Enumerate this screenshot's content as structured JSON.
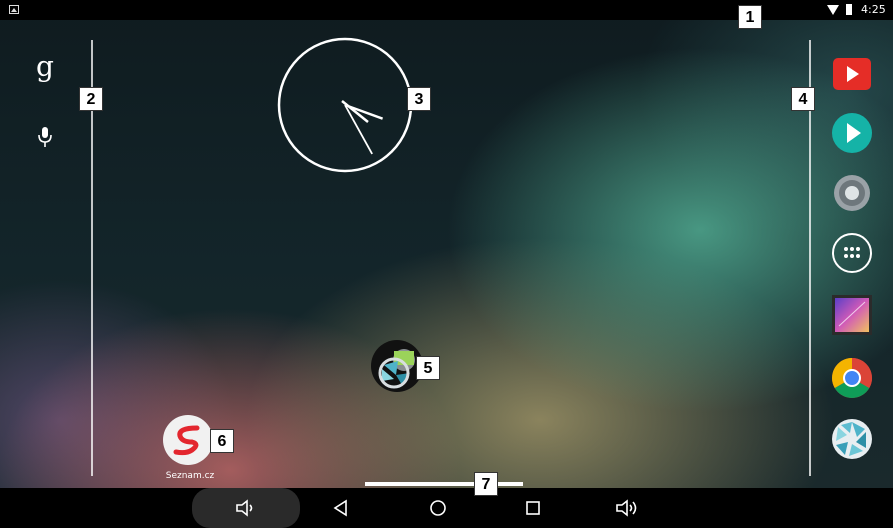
{
  "status_bar": {
    "notification_icon": "image-icon",
    "wifi_icon": "wifi-icon",
    "battery_icon": "battery-icon",
    "time": "4:25"
  },
  "left_panel": {
    "google_search_glyph": "g",
    "voice_icon": "microphone-icon"
  },
  "clock_widget": {
    "hour_hand_deg": 150,
    "minute_hand_deg": 151,
    "style": "analog"
  },
  "desktop": {
    "folder": {
      "icon": "photo-aperture-folder-icon"
    },
    "seznam": {
      "label": "Seznam.cz",
      "glyph": "S",
      "color": "#e3262e"
    }
  },
  "dock_apps": [
    {
      "name": "YouTube",
      "icon": "youtube-icon",
      "color": "#e52d27"
    },
    {
      "name": "Play Store",
      "icon": "play-store-icon",
      "color": "#15b3a7"
    },
    {
      "name": "Settings",
      "icon": "settings-gear-icon",
      "color": "#9aa2a7"
    },
    {
      "name": "Apps",
      "icon": "app-drawer-icon",
      "color": "#ffffff"
    },
    {
      "name": "Gallery",
      "icon": "gallery-icon",
      "color": "#a05ad0"
    },
    {
      "name": "Chrome",
      "icon": "chrome-icon",
      "color": "#db4437"
    },
    {
      "name": "Camera",
      "icon": "aperture-icon",
      "color": "#4fb3c9"
    }
  ],
  "nav_bar": {
    "volume_down_icon": "volume-down-icon",
    "back_icon": "back-triangle-icon",
    "home_icon": "home-circle-icon",
    "recents_icon": "recents-square-icon",
    "volume_up_icon": "volume-up-icon"
  },
  "callouts": [
    "1",
    "2",
    "3",
    "4",
    "5",
    "6",
    "7"
  ]
}
